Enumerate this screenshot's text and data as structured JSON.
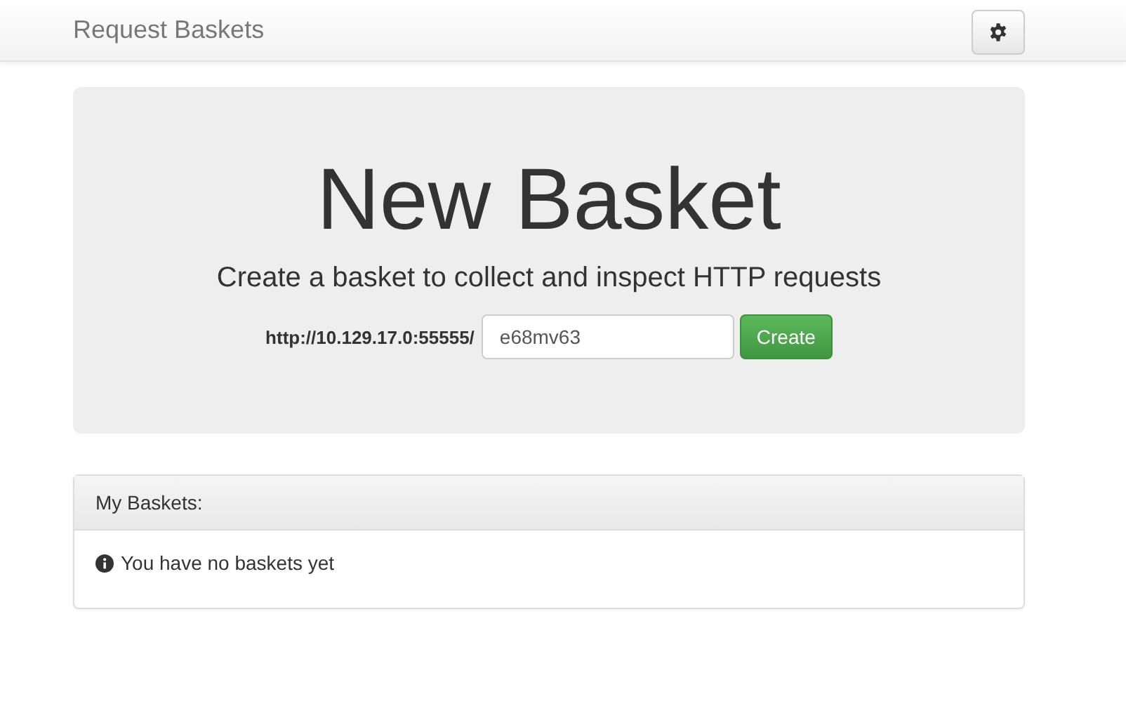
{
  "navbar": {
    "brand": "Request Baskets"
  },
  "hero": {
    "title": "New Basket",
    "subtitle": "Create a basket to collect and inspect HTTP requests",
    "url_prefix": "http://10.129.17.0:55555/",
    "basket_name": "e68mv63",
    "button": "Create"
  },
  "panel": {
    "heading": "My Baskets:",
    "message": "You have no baskets yet"
  }
}
